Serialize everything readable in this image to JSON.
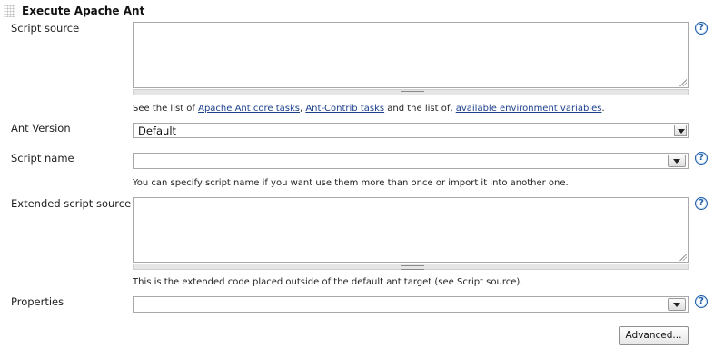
{
  "section": {
    "title": "Execute Apache Ant"
  },
  "script_source": {
    "label": "Script source",
    "value": "",
    "help_icon": "question-mark-icon",
    "desc_prefix": "See the list of ",
    "link_core_tasks": "Apache Ant core tasks",
    "sep1": ", ",
    "link_contrib_tasks": "Ant-Contrib tasks",
    "desc_middle": " and the list of, ",
    "link_env_vars": "available environment variables",
    "desc_suffix": "."
  },
  "ant_version": {
    "label": "Ant Version",
    "selected": "Default"
  },
  "script_name": {
    "label": "Script name",
    "value": "",
    "help_icon": "question-mark-icon",
    "description": "You can specify script name if you want use them more than once or import it into another one."
  },
  "extended_script_source": {
    "label": "Extended script source",
    "value": "",
    "help_icon": "question-mark-icon",
    "description": "This is the extended code placed outside of the default ant target (see Script source)."
  },
  "properties": {
    "label": "Properties",
    "value": "",
    "help_icon": "question-mark-icon"
  },
  "advanced_button": {
    "label": "Advanced..."
  },
  "colors": {
    "link": "#1a3f8b",
    "help_icon": "#1f5ea8",
    "border": "#a9a9a9"
  }
}
